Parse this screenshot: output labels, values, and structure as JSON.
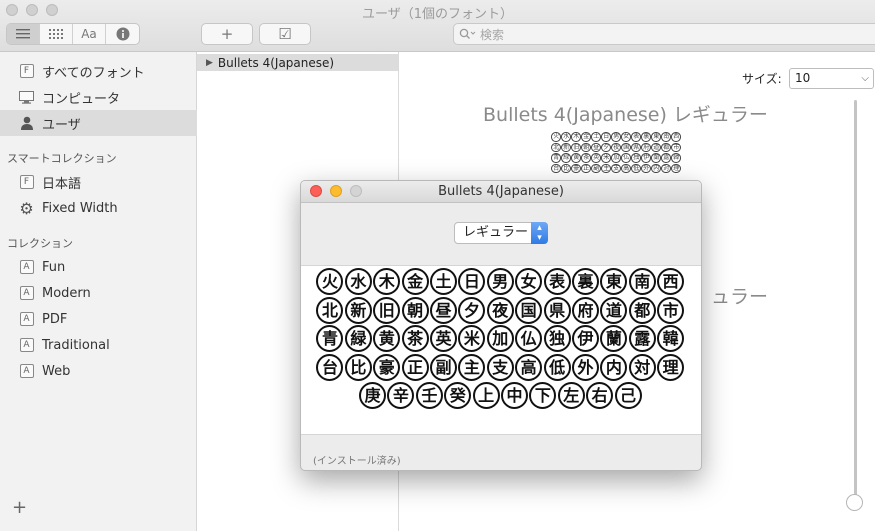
{
  "window": {
    "title": "ユーザ（1個のフォント）"
  },
  "toolbar": {
    "view_icons": [
      "list-view-icon",
      "grid-view-icon",
      "sample-view-icon",
      "info-icon"
    ],
    "sample_label": "Aa",
    "add_label": "+",
    "check_label": "☑",
    "search_placeholder": "検索"
  },
  "sidebar": {
    "items": [
      {
        "label": "すべてのフォント",
        "icon": "font-box-icon"
      },
      {
        "label": "コンピュータ",
        "icon": "computer-icon"
      },
      {
        "label": "ユーザ",
        "icon": "user-icon",
        "selected": true
      }
    ],
    "smart_heading": "スマートコレクション",
    "smart_items": [
      {
        "label": "日本語",
        "icon": "font-box-icon"
      },
      {
        "label": "Fixed Width",
        "icon": "gear-icon"
      }
    ],
    "collection_heading": "コレクション",
    "collections": [
      {
        "label": "Fun"
      },
      {
        "label": "Modern"
      },
      {
        "label": "PDF"
      },
      {
        "label": "Traditional"
      },
      {
        "label": "Web"
      }
    ],
    "add_label": "+"
  },
  "family_list": {
    "selected": "Bullets 4(Japanese)"
  },
  "preview": {
    "size_label": "サイズ:",
    "size_value": "10",
    "title": "Bullets 4(Japanese) レギュラー",
    "title_partial": "ュラー",
    "mini_glyphs": "火水木金土日男女表裏東南西北新旧朝昼夕夜国県府道都市青緑黄茶英米加仏独伊蘭露韓台比豪正副主支高低外内対理"
  },
  "font_window": {
    "title": "Bullets 4(Japanese)",
    "style_value": "レギュラー",
    "rows": [
      [
        "火",
        "水",
        "木",
        "金",
        "土",
        "日",
        "男",
        "女",
        "表",
        "裏",
        "東",
        "南",
        "西"
      ],
      [
        "北",
        "新",
        "旧",
        "朝",
        "昼",
        "夕",
        "夜",
        "国",
        "県",
        "府",
        "道",
        "都",
        "市"
      ],
      [
        "青",
        "緑",
        "黄",
        "茶",
        "英",
        "米",
        "加",
        "仏",
        "独",
        "伊",
        "蘭",
        "露",
        "韓"
      ],
      [
        "台",
        "比",
        "豪",
        "正",
        "副",
        "主",
        "支",
        "高",
        "低",
        "外",
        "内",
        "対",
        "理"
      ],
      [
        "庚",
        "辛",
        "壬",
        "癸",
        "上",
        "中",
        "下",
        "左",
        "右",
        "己"
      ]
    ],
    "status": "(インストール済み)"
  }
}
